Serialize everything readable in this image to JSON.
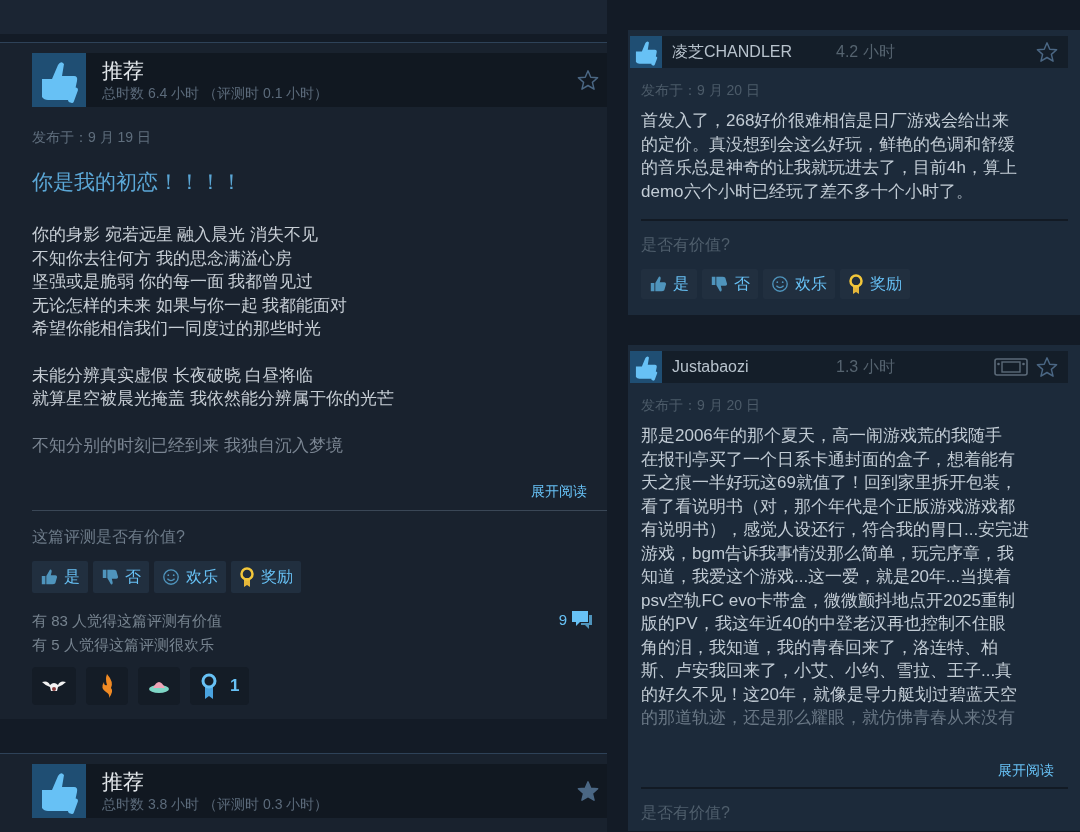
{
  "left_column": {
    "reviews": [
      {
        "verdict": "推荐",
        "hours": "总时数 6.4 小时 （评测时 0.1 小时）",
        "starred": false,
        "posted": "发布于：9 月 19 日",
        "title": "你是我的初恋！！！！",
        "paragraphs": [
          [
            "你的身影 宛若远星 融入晨光 消失不见",
            "不知你去往何方 我的思念满溢心房",
            "坚强或是脆弱 你的每一面 我都曾见过",
            "无论怎样的未来 如果与你一起 我都能面对",
            "希望你能相信我们一同度过的那些时光"
          ],
          [
            "未能分辨真实虚假 长夜破晓 白昼将临",
            "就算星空被晨光掩盖 我依然能分辨属于你的光芒"
          ],
          [
            "不知分别的时刻已经到来 我独自沉入梦境"
          ]
        ],
        "read_more": "展开阅读",
        "helpful_prompt": "这篇评测是否有价值?",
        "vote_buttons": [
          {
            "kind": "yes",
            "label": "是"
          },
          {
            "kind": "no",
            "label": "否"
          },
          {
            "kind": "funny",
            "label": "欢乐"
          },
          {
            "kind": "award",
            "label": "奖励"
          }
        ],
        "stats": [
          "有 83 人觉得这篇评测有价值",
          "有 5 人觉得这篇评测很欢乐"
        ],
        "comment_count": "9",
        "awards": [
          {
            "kind": "bat"
          },
          {
            "kind": "flame"
          },
          {
            "kind": "cake"
          },
          {
            "kind": "ribbon",
            "count": "1"
          }
        ]
      },
      {
        "verdict": "推荐",
        "hours": "总时数 3.8 小时 （评测时 0.3 小时）",
        "starred": true
      }
    ]
  },
  "right_column": {
    "reviews": [
      {
        "author": "凌芝CHANDLER",
        "hours": "4.2 小时",
        "handheld": false,
        "starred": false,
        "posted": "发布于：9 月 20 日",
        "lines": [
          "首发入了，268好价很难相信是日厂游戏会给出来",
          "的定价。真没想到会这么好玩，鲜艳的色调和舒缓",
          "的音乐总是神奇的让我就玩进去了，目前4h，算上",
          "demo六个小时已经玩了差不多十个小时了。"
        ],
        "helpful_prompt": "是否有价值?",
        "vote_buttons": [
          {
            "kind": "yes",
            "label": "是"
          },
          {
            "kind": "no",
            "label": "否"
          },
          {
            "kind": "funny",
            "label": "欢乐"
          },
          {
            "kind": "award",
            "label": "奖励"
          }
        ]
      },
      {
        "author": "Justabaozi",
        "hours": "1.3 小时",
        "handheld": true,
        "starred": false,
        "posted": "发布于：9 月 20 日",
        "lines": [
          "那是2006年的那个夏天，高一闹游戏荒的我随手",
          "在报刊亭买了一个日系卡通封面的盒子，想着能有",
          "天之痕一半好玩这69就值了！回到家里拆开包装，",
          "看了看说明书（对，那个年代是个正版游戏游戏都",
          "有说明书），感觉人设还行，符合我的胃口...安完进",
          "游戏，bgm告诉我事情没那么简单，玩完序章，我",
          "知道，我爱这个游戏...这一爱，就是20年...当摸着",
          "psv空轨FC evo卡带盒，微微颤抖地点开2025重制",
          "版的PV，我这年近40的中登老汉再也控制不住眼",
          "角的泪，我知道，我的青春回来了，洛连特、柏",
          "斯、卢安我回来了，小艾、小约、雪拉、王子...真",
          "的好久不见！这20年，就像是导力艇划过碧蓝天空",
          "的那道轨迹，还是那么耀眼，就仿佛青春从来没有"
        ],
        "read_more": "展开阅读",
        "helpful_prompt": "是否有价值?"
      }
    ]
  }
}
